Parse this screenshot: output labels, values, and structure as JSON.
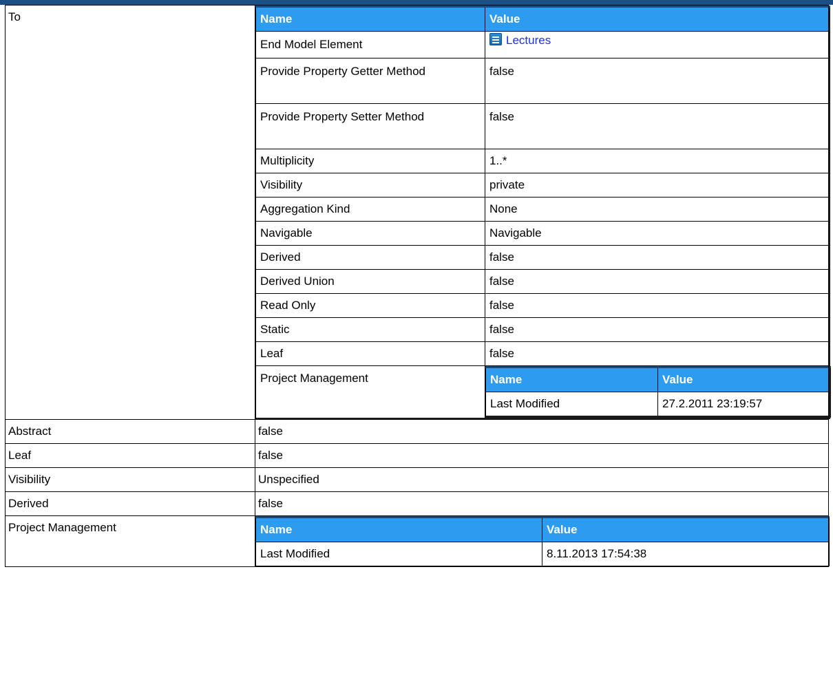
{
  "outer_rows": {
    "to_label": "To",
    "abstract": {
      "label": "Abstract",
      "value": "false"
    },
    "leaf": {
      "label": "Leaf",
      "value": "false"
    },
    "visibility": {
      "label": "Visibility",
      "value": "Unspecified"
    },
    "derived": {
      "label": "Derived",
      "value": "false"
    },
    "project_management_label": "Project Management"
  },
  "to_table": {
    "headers": {
      "name": "Name",
      "value": "Value"
    },
    "end_model_element": {
      "label": "End Model Element",
      "value": "Lectures",
      "icon": "class-icon"
    },
    "rows": [
      {
        "label": "Provide Property Getter Method",
        "value": "false"
      },
      {
        "label": "Provide Property Setter Method",
        "value": "false"
      },
      {
        "label": "Multiplicity",
        "value": "1..*"
      },
      {
        "label": "Visibility",
        "value": "private"
      },
      {
        "label": "Aggregation Kind",
        "value": "None"
      },
      {
        "label": "Navigable",
        "value": "Navigable"
      },
      {
        "label": "Derived",
        "value": "false"
      },
      {
        "label": "Derived Union",
        "value": "false"
      },
      {
        "label": "Read Only",
        "value": "false"
      },
      {
        "label": "Static",
        "value": "false"
      },
      {
        "label": "Leaf",
        "value": "false"
      }
    ],
    "project_management": {
      "label": "Project Management",
      "headers": {
        "name": "Name",
        "value": "Value"
      },
      "last_modified_label": "Last Modified",
      "last_modified_value": "27.2.2011 23:19:57"
    }
  },
  "bottom_pm": {
    "headers": {
      "name": "Name",
      "value": "Value"
    },
    "last_modified_label": "Last Modified",
    "last_modified_value": "8.11.2013 17:54:38"
  },
  "colors": {
    "header_bg": "#2d9bf0",
    "link": "#1a2ef0",
    "top_bar": "#1c4f86"
  }
}
